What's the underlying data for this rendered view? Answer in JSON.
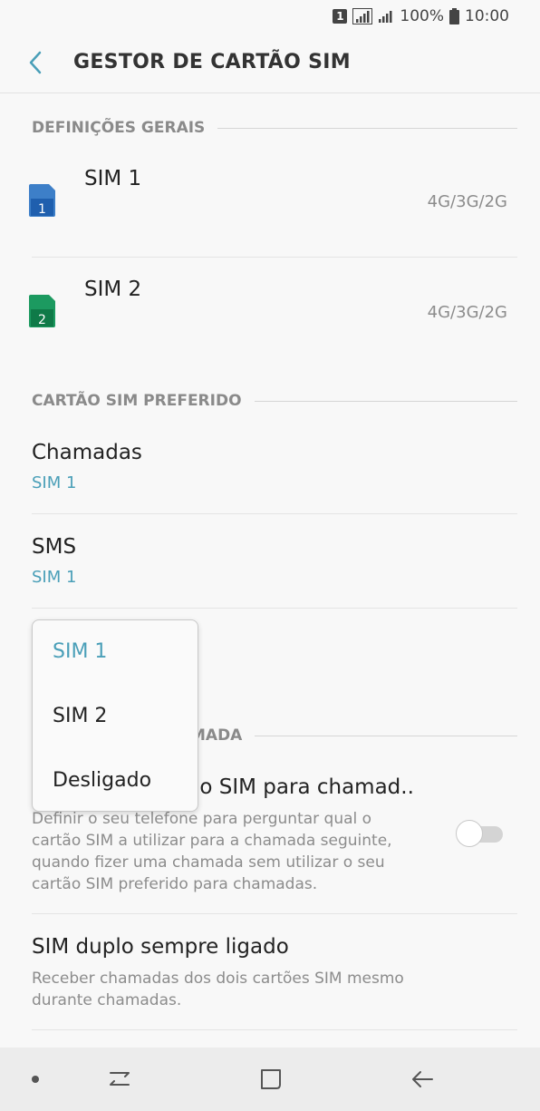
{
  "status_bar": {
    "sim_badge": "1",
    "battery": "100%",
    "time": "10:00"
  },
  "header": {
    "title": "GESTOR DE CARTÃO SIM"
  },
  "sections": {
    "general": "DEFINIÇÕES GERAIS",
    "preferred": "CARTÃO SIM PREFERIDO",
    "calls_partial": "MADA"
  },
  "sims": [
    {
      "name": "SIM 1",
      "number": "1",
      "network": "4G/3G/2G",
      "color": "#3d7fc8"
    },
    {
      "name": "SIM 2",
      "number": "2",
      "network": "4G/3G/2G",
      "color": "#1c9a60"
    }
  ],
  "preferred": {
    "calls": {
      "title": "Chamadas",
      "value": "SIM 1"
    },
    "sms": {
      "title": "SMS",
      "value": "SIM 1"
    }
  },
  "ask_sim": {
    "title_partial": "io SIM para chamad..",
    "description": [
      "Definir o seu telefone para perguntar qual o",
      "cartão SIM a utilizar para a chamada seguinte,",
      "quando fizer uma chamada sem utilizar o seu",
      "cartão SIM preferido para chamadas."
    ],
    "toggle_on": false
  },
  "dual_sim": {
    "title": "SIM duplo sempre ligado",
    "description": [
      "Receber chamadas dos dois cartões SIM mesmo",
      "durante chamadas."
    ]
  },
  "dropdown": {
    "options": [
      "SIM 1",
      "SIM 2",
      "Desligado"
    ],
    "selected": "SIM 1"
  },
  "colors": {
    "accent": "#4a9fb8",
    "sim1": "#3d7fc8",
    "sim2": "#1c9a60"
  }
}
